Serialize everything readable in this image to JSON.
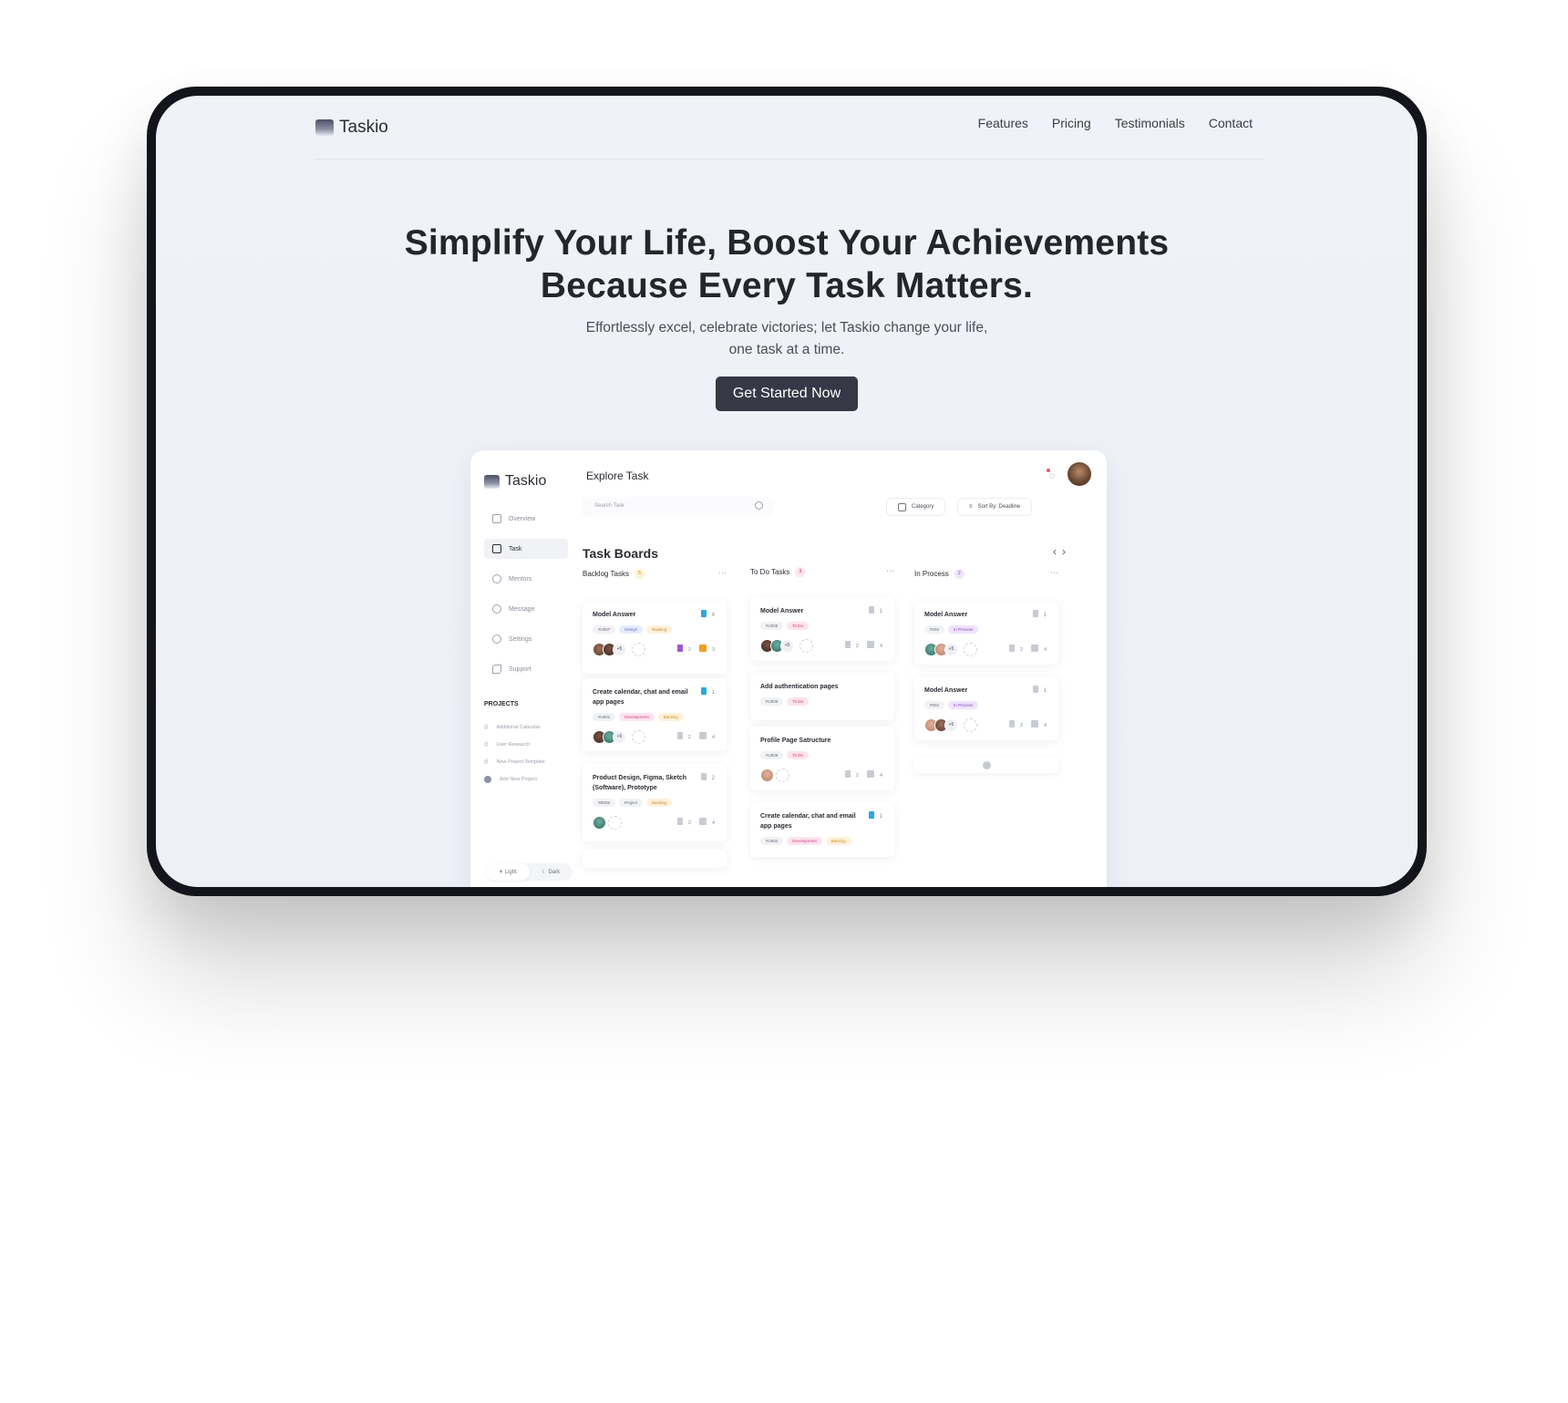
{
  "site": {
    "brand": "Taskio",
    "nav": [
      "Features",
      "Pricing",
      "Testimonials",
      "Contact"
    ]
  },
  "hero": {
    "headline_1": "Simplify Your Life, Boost Your Achievements",
    "headline_2": "Because Every Task Matters.",
    "subtitle_1": "Effortlessly excel, celebrate victories; let Taskio change your life,",
    "subtitle_2": "one task at a time.",
    "cta": "Get Started Now"
  },
  "app": {
    "brand": "Taskio",
    "page_title": "Explore Task",
    "search_placeholder": "Search Task",
    "category": "Category",
    "sort": "Sort By: Deadline",
    "board_title": "Task Boards",
    "menu": [
      "Overview",
      "Task",
      "Mentors",
      "Message",
      "Settings",
      "Support"
    ],
    "projects_label": "PROJECTS",
    "projects": [
      "Additional Calendar",
      "User Research",
      "New Project Template",
      "Add New Project"
    ],
    "theme": [
      "Light",
      "Dark"
    ],
    "columns": [
      {
        "title": "Backlog Tasks",
        "count": "5",
        "cards": [
          {
            "title": "Model Answer",
            "count": "4",
            "tags": [
              "#U007",
              "Design",
              "Backlog"
            ],
            "plus": "+5",
            "files": "2",
            "comments": "3"
          },
          {
            "title": "Create calendar, chat and email app pages",
            "count": "1",
            "tags": [
              "#U002",
              "Development",
              "Backlog"
            ],
            "plus": "+5",
            "files": "2",
            "comments": "4"
          },
          {
            "title": "Product Design, Figma, Sketch (Software), Prototype",
            "count": "2",
            "tags": [
              "#B005",
              "Project",
              "Backlog"
            ],
            "plus": "",
            "files": "2",
            "comments": "4"
          }
        ]
      },
      {
        "title": "To Do Tasks",
        "count": "3",
        "cards": [
          {
            "title": "Model Answer",
            "count": "1",
            "tags": [
              "#U005",
              "To Do"
            ],
            "plus": "+5",
            "files": "2",
            "comments": "4"
          },
          {
            "title": "Add authentication pages",
            "count": "",
            "tags": [
              "#U008",
              "To Do"
            ],
            "plus": "",
            "files": "",
            "comments": ""
          },
          {
            "title": "Profile Page Satructure",
            "count": "",
            "tags": [
              "#U006",
              "To Do"
            ],
            "plus": "",
            "files": "2",
            "comments": "4"
          },
          {
            "title": "Create calendar, chat and email app pages",
            "count": "1",
            "tags": [
              "#U002",
              "Development",
              "Backlog"
            ],
            "plus": "",
            "files": "",
            "comments": ""
          }
        ]
      },
      {
        "title": "In Process",
        "count": "2",
        "cards": [
          {
            "title": "Model Answer",
            "count": "1",
            "tags": [
              "#002",
              "In Process"
            ],
            "plus": "+5",
            "files": "2",
            "comments": "4"
          },
          {
            "title": "Model Answer",
            "count": "1",
            "tags": [
              "#002",
              "In Process"
            ],
            "plus": "+5",
            "files": "2",
            "comments": "4"
          }
        ]
      }
    ]
  }
}
